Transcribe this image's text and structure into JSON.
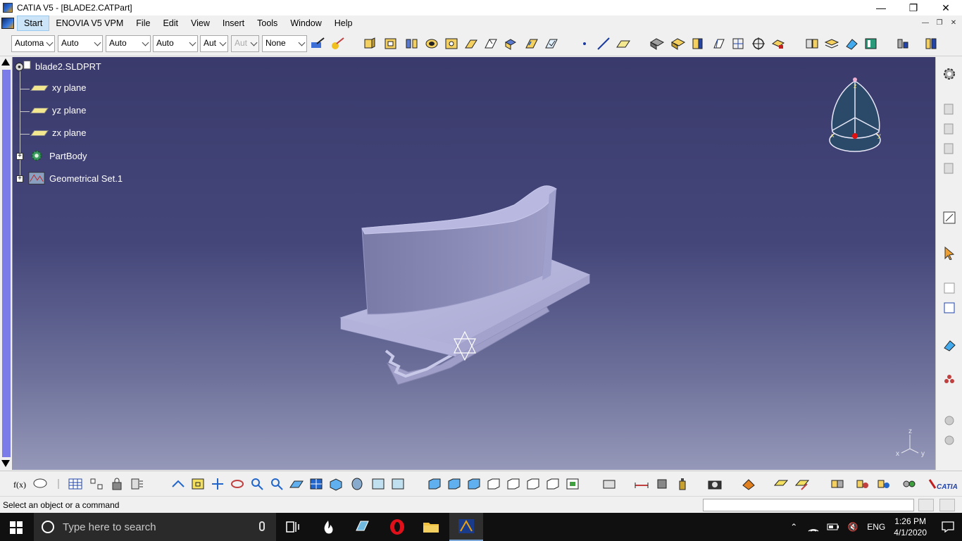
{
  "window": {
    "title": "CATIA V5 - [BLADE2.CATPart]",
    "minimize": "—",
    "maximize": "❐",
    "close": "✕"
  },
  "menubar": {
    "items": [
      "Start",
      "ENOVIA V5 VPM",
      "File",
      "Edit",
      "View",
      "Insert",
      "Tools",
      "Window",
      "Help"
    ]
  },
  "toolbar_top": {
    "combos": [
      {
        "value": "Automa",
        "disabled": false
      },
      {
        "value": "Auto",
        "disabled": false
      },
      {
        "value": "Auto",
        "disabled": false
      },
      {
        "value": "Auto",
        "disabled": false
      },
      {
        "value": "Aut",
        "disabled": false
      },
      {
        "value": "Aut",
        "disabled": true
      },
      {
        "value": "None",
        "disabled": false
      }
    ]
  },
  "tree": {
    "root": "blade2.SLDPRT",
    "nodes": [
      "xy plane",
      "yz plane",
      "zx plane",
      "PartBody",
      "Geometrical Set.1"
    ]
  },
  "compass": {
    "x_label": "x",
    "y_label": "y",
    "z_label": "z"
  },
  "axis_triad": {
    "x": "x",
    "y": "y",
    "z": "z"
  },
  "status": {
    "message": "Select an object or a command",
    "command_input": ""
  },
  "taskbar": {
    "search_placeholder": "Type here to search",
    "language": "ENG",
    "time": "1:26 PM",
    "date": "4/1/2020"
  },
  "colors": {
    "viewport_top": "#3a3a6c",
    "viewport_bottom": "#9598b8",
    "part": "#a9a9d4",
    "tree_scrollbar": "#7c7ce8"
  }
}
